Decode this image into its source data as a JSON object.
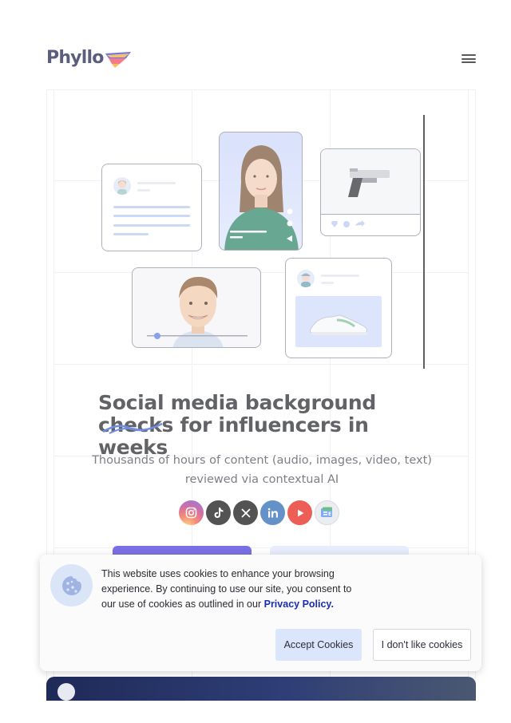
{
  "header": {
    "logo_text": "Phyllo",
    "menu_icon": "hamburger-icon"
  },
  "hero": {
    "title_line1": "Social media background",
    "title_struck_word": "checks",
    "title_line2_rest": " for influencers in weeks",
    "subtitle": "Thousands of hours of content (audio, images, video, text) reviewed via contextual AI",
    "social_icons": [
      "instagram-icon",
      "tiktok-icon",
      "x-icon",
      "linkedin-icon",
      "youtube-icon",
      "google-news-icon"
    ],
    "colors": {
      "accent": "#4638dd",
      "secondary_button": "#dfe5fb",
      "title": "#26272d"
    }
  },
  "cookie_banner": {
    "text": "This website uses cookies to enhance your browsing experience. By continuing to use our site, you consent to our use of cookies as outlined in our ",
    "privacy_link": "Privacy Policy.",
    "accept_label": "Accept Cookies",
    "decline_label": "I don't like cookies",
    "icon": "cookie-icon"
  }
}
